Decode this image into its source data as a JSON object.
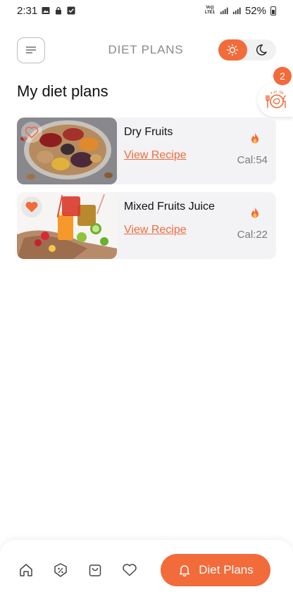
{
  "status_bar": {
    "time": "2:31",
    "network": "Vo)) LTE1",
    "battery": "52%"
  },
  "header": {
    "title": "DIET PLANS",
    "menu_icon": "menu-lines-icon",
    "theme_light_icon": "sun-icon",
    "theme_dark_icon": "moon-icon",
    "theme_active": "light"
  },
  "section": {
    "title": "My diet plans"
  },
  "cart": {
    "icon": "diet-plate-icon",
    "badge_count": "2"
  },
  "plans": [
    {
      "name": "Dry Fruits",
      "link_label": "View Recipe",
      "calories": "Cal:54",
      "favorite": false,
      "image": "dry-fruits-platter"
    },
    {
      "name": "Mixed Fruits Juice",
      "link_label": "View Recipe",
      "calories": "Cal:22",
      "favorite": true,
      "image": "fruit-juices"
    }
  ],
  "bottom_nav": {
    "items": [
      "home-icon",
      "offer-tag-icon",
      "shopping-bag-icon",
      "heart-icon"
    ],
    "active_label": "Diet Plans",
    "active_icon": "bell-icon"
  },
  "colors": {
    "accent": "#f26b3a",
    "card_bg": "#f3f2f5",
    "muted_text": "#8a8a8a"
  }
}
